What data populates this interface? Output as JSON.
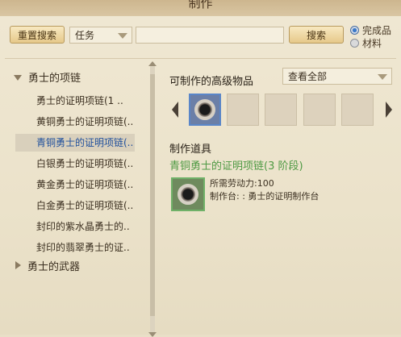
{
  "window": {
    "title": "制作"
  },
  "search": {
    "reset_label": "重置搜索",
    "filter_value": "任务",
    "query": "",
    "search_label": "搜索",
    "mode_options": [
      {
        "label": "完成品",
        "selected": true
      },
      {
        "label": "材料",
        "selected": false
      }
    ]
  },
  "tree": {
    "categories": [
      {
        "label": "勇士的项链",
        "expanded": true,
        "items": [
          "勇士的证明项链(1 ..",
          "黄铜勇士的证明项链(..",
          "青铜勇士的证明项链(..",
          "白银勇士的证明项链(..",
          "黄金勇士的证明项链(..",
          "白金勇士的证明项链(..",
          "封印的紫水晶勇士的..",
          "封印的翡翠勇士的证.."
        ],
        "selected_index": 2
      },
      {
        "label": "勇士的武器",
        "expanded": false,
        "items": []
      }
    ]
  },
  "advanced": {
    "title": "可制作的高级物品",
    "view_filter": "查看全部",
    "slot_count": 5,
    "selected_slot": 0
  },
  "craft": {
    "section_title": "制作道具",
    "item_name": "青铜勇士的证明项链(3 阶段)",
    "labor_required": "所需劳动力:100",
    "workbench": "制作台: : 勇士的证明制作台"
  },
  "colors": {
    "accent_green": "#4f9a44",
    "selected_blue": "#1f4f9c"
  }
}
